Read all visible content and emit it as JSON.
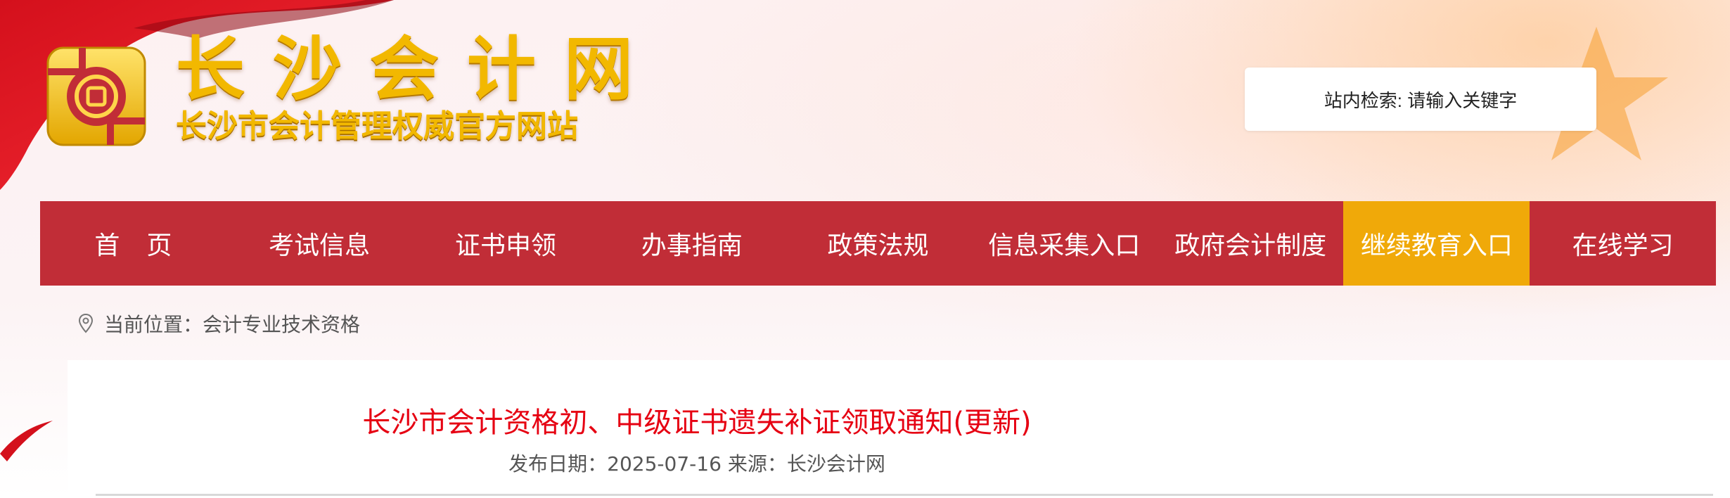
{
  "header": {
    "site_name": "长沙会计网",
    "slogan": "长沙市会计管理权威官方网站",
    "search_text": "站内检索: 请输入关键字"
  },
  "nav": {
    "items": [
      {
        "label": "首页"
      },
      {
        "label": "考试信息"
      },
      {
        "label": "证书申领"
      },
      {
        "label": "办事指南"
      },
      {
        "label": "政策法规"
      },
      {
        "label": "信息采集入口"
      },
      {
        "label": "政府会计制度"
      },
      {
        "label": "继续教育入口",
        "active": true
      },
      {
        "label": "在线学习"
      }
    ]
  },
  "breadcrumb": {
    "prefix": "当前位置：",
    "current": "会计专业技术资格"
  },
  "article": {
    "title": "长沙市会计资格初、中级证书遗失补证领取通知(更新)",
    "date_label": "发布日期：",
    "date": "2025-07-16",
    "source_label": "来源：",
    "source": "长沙会计网"
  },
  "colors": {
    "nav_bg": "#c12d37",
    "nav_active": "#f0a909",
    "title_red": "#e60012",
    "brand_gold": "#f2b800"
  },
  "icons": {
    "breadcrumb": "location-pin-icon",
    "logo": "emblem-logo-icon"
  }
}
